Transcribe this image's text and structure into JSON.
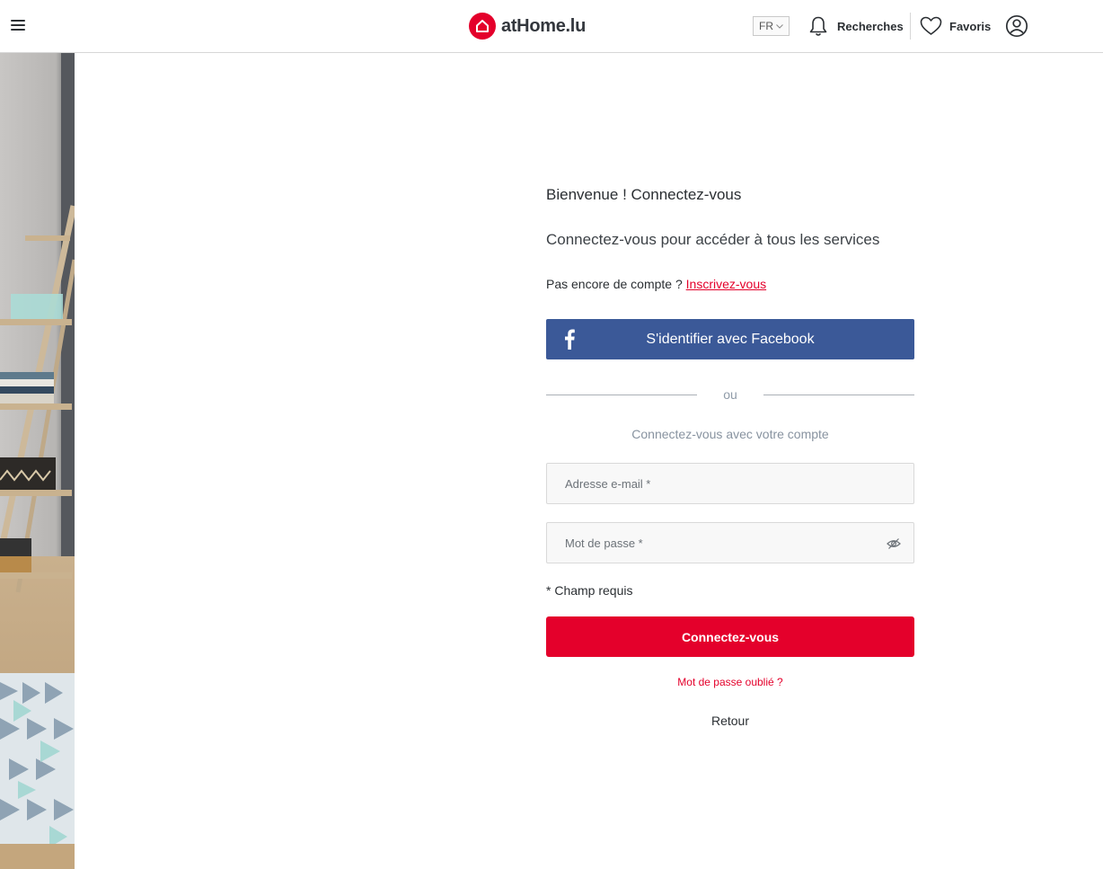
{
  "header": {
    "menu_icon": "hamburger-menu-icon",
    "logo_text": "atHome.lu",
    "language": "FR",
    "searches_label": "Recherches",
    "favorites_label": "Favoris",
    "account_icon": "user-account-icon"
  },
  "login": {
    "welcome": "Bienvenue ! Connectez-vous",
    "subtitle": "Connectez-vous pour accéder à tous les services",
    "no_account_text": "Pas encore de compte ?",
    "signup_link": "Inscrivez-vous",
    "facebook_button": "S'identifier avec Facebook",
    "divider_text": "ou",
    "account_hint": "Connectez-vous avec votre compte",
    "email_placeholder": "Adresse e-mail *",
    "password_placeholder": "Mot de passe *",
    "required_note": "* Champ requis",
    "submit_button": "Connectez-vous",
    "forgot_password": "Mot de passe oublié ?",
    "back_link": "Retour"
  },
  "colors": {
    "brand_red": "#e4002b",
    "facebook_blue": "#3b5998",
    "text_dark": "#2b2f33",
    "muted": "#8893a0"
  }
}
